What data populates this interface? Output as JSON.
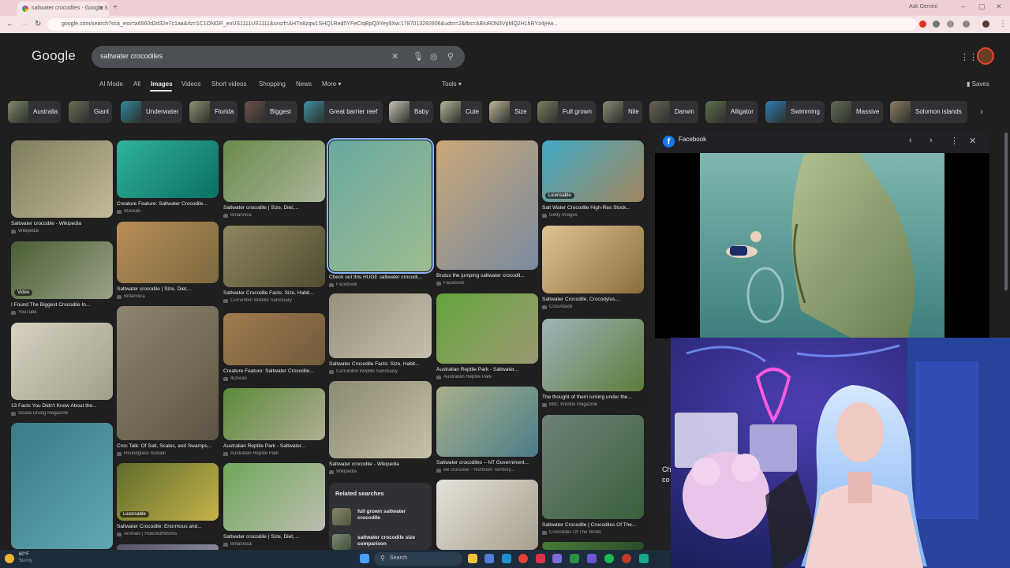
{
  "browser": {
    "tab_title": "saltwater crocodiles - Google S",
    "ask_gemini": "Ask Gemini",
    "url": "google.com/search?sca_esv=a6560d2d32e7c1aa&rlz=1C1ONGR_enUS1111US1111&sxsrf=AHTn8zqw1SHQ1Red5YFeCIqBpQ3Yey9Xw:1787013292606&udm=2&fbs=ABIuR0N3VpMQ2H1hRYz4jHw..."
  },
  "google": {
    "logo": "Google",
    "query": "saltwater crocodiles",
    "nav": {
      "ai_mode": "AI Mode",
      "all": "All",
      "images": "Images",
      "videos": "Videos",
      "short_videos": "Short videos",
      "shopping": "Shopping",
      "news": "News",
      "more": "More",
      "tools": "Tools",
      "saves": "Saves"
    },
    "chips": [
      "Australia",
      "Giant",
      "Underwater",
      "Florida",
      "Biggest",
      "Great barrier reef",
      "Baby",
      "Cute",
      "Size",
      "Full grown",
      "Nile",
      "Darwin",
      "Alligator",
      "Swimming",
      "Massive",
      "Solomon islands"
    ]
  },
  "results": {
    "c1": [
      {
        "cap": "Saltwater crocodile - Wikipedia",
        "src": "Wikipedia"
      },
      {
        "cap": "I Found The Biggest Crocodile In...",
        "src": "YouTube",
        "badge": "Video"
      },
      {
        "cap": "13 Facts You Didn't Know About the...",
        "src": "Scuba Diving Magazine"
      }
    ],
    "c2": [
      {
        "cap": "Creature Feature: Saltwater Crocodile...",
        "src": "4Ocean"
      },
      {
        "cap": "Saltwater crocodile | Size, Diet,...",
        "src": "Britannica"
      },
      {
        "cap": "Croc Talk: Of Salt, Scales, and Swamps...",
        "src": "Roundglass Sustain"
      },
      {
        "cap": "Saltwater Crocodile: Enormous and...",
        "src": "Animals | HowStuffWorks",
        "badge": "Licensable"
      }
    ],
    "c3": [
      {
        "cap": "Saltwater crocodile | Size, Diet,...",
        "src": "Britannica"
      },
      {
        "cap": "Saltwater Crocodile Facts: Size, Habit...",
        "src": "Currumbin Wildlife Sanctuary"
      },
      {
        "cap": "Creature Feature: Saltwater Crocodile...",
        "src": "4Ocean"
      },
      {
        "cap": "Australian Reptile Park - Saltwater...",
        "src": "Australian Reptile Park"
      },
      {
        "cap": "Saltwater crocodile | Size, Diet,...",
        "src": "Britannica"
      }
    ],
    "c4": [
      {
        "cap": "Check out this HUGE saltwater crocodi...",
        "src": "Facebook"
      },
      {
        "cap": "Saltwater Crocodile Facts: Size, Habit...",
        "src": "Currumbin Wildlife Sanctuary"
      },
      {
        "cap": "Saltwater crocodile - Wikipedia",
        "src": "Wikipedia"
      }
    ],
    "c5": [
      {
        "cap": "Brutus the jumping saltwater crocodil...",
        "src": "Facebook"
      },
      {
        "cap": "Australian Reptile Park - Saltwater...",
        "src": "Australian Reptile Park"
      },
      {
        "cap": "Saltwater crocodiles – NT Government...",
        "src": "Be crocwise – Northern Territory..."
      }
    ],
    "c6": [
      {
        "cap": "Salt Water Crocodile High-Res Stock...",
        "src": "Getty Images",
        "badge": "Licensable"
      },
      {
        "cap": "Saltwater Crocodile, Crocodylus...",
        "src": "CrocAttack"
      },
      {
        "cap": "The thought of them lurking under the...",
        "src": "BBC Wildlife Magazine"
      },
      {
        "cap": "Saltwater Crocodile | Crocodiles Of The...",
        "src": "Crocodiles Of The World"
      }
    ],
    "related": {
      "title": "Related searches",
      "items": [
        "full grown saltwater crocodile",
        "saltwater crocodile size comparison"
      ]
    }
  },
  "preview": {
    "source": "Facebook",
    "partial_text": "Ch",
    "partial_text2": "co"
  },
  "taskbar": {
    "temp": "60°F",
    "weather": "Sunny",
    "search": "Search"
  }
}
